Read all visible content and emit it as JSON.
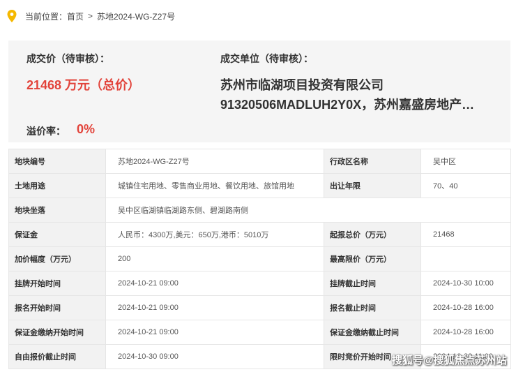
{
  "breadcrumb": {
    "prefix": "当前位置：",
    "home": "首页",
    "separator": ">",
    "current": "苏地2024-WG-Z27号"
  },
  "summary": {
    "price_label": "成交价（待审核）：",
    "price_value": "21468 万元（总价）",
    "buyer_label": "成交单位（待审核）：",
    "buyer_line1": "苏州市临湖项目投资有限公司",
    "buyer_line2": "91320506MADLUH2Y0X，苏州嘉盛房地产…",
    "premium_label": "溢价率：",
    "premium_value": "0%"
  },
  "table": {
    "r1": {
      "k1": "地块编号",
      "v1": "苏地2024-WG-Z27号",
      "k2": "行政区名称",
      "v2": "吴中区"
    },
    "r2": {
      "k1": "土地用途",
      "v1": "城镇住宅用地、零售商业用地、餐饮用地、旅馆用地",
      "k2": "出让年限",
      "v2": "70、40"
    },
    "r3": {
      "k1": "地块坐落",
      "v1": "吴中区临湖镇临湖路东侧、碧湖路南侧"
    },
    "r4": {
      "k1": "保证金",
      "v1": "人民币：4300万,美元：650万,港币：5010万",
      "k2": "起报总价（万元）",
      "v2": "21468"
    },
    "r5": {
      "k1": "加价幅度（万元）",
      "v1": "200",
      "k2": "最高限价（万元）",
      "v2": ""
    },
    "r6": {
      "k1": "挂牌开始时间",
      "v1": "2024-10-21 09:00",
      "k2": "挂牌截止时间",
      "v2": "2024-10-30 10:00"
    },
    "r7": {
      "k1": "报名开始时间",
      "v1": "2024-10-21 09:00",
      "k2": "报名截止时间",
      "v2": "2024-10-28 16:00"
    },
    "r8": {
      "k1": "保证金缴纳开始时间",
      "v1": "2024-10-21 09:00",
      "k2": "保证金缴纳截止时间",
      "v2": "2024-10-28 16:00"
    },
    "r9": {
      "k1": "自由报价截止时间",
      "v1": "2024-10-30 09:00",
      "k2": "限时竞价开始时间",
      "v2": "2024-10-30 11:00"
    }
  },
  "watermark": "搜狐号@搜狐焦点苏州站",
  "colors": {
    "accent_red": "#e2433a",
    "pin_yellow": "#f5b800",
    "label_bg": "#f2f2f2",
    "panel_bg": "#f5f5f5"
  }
}
